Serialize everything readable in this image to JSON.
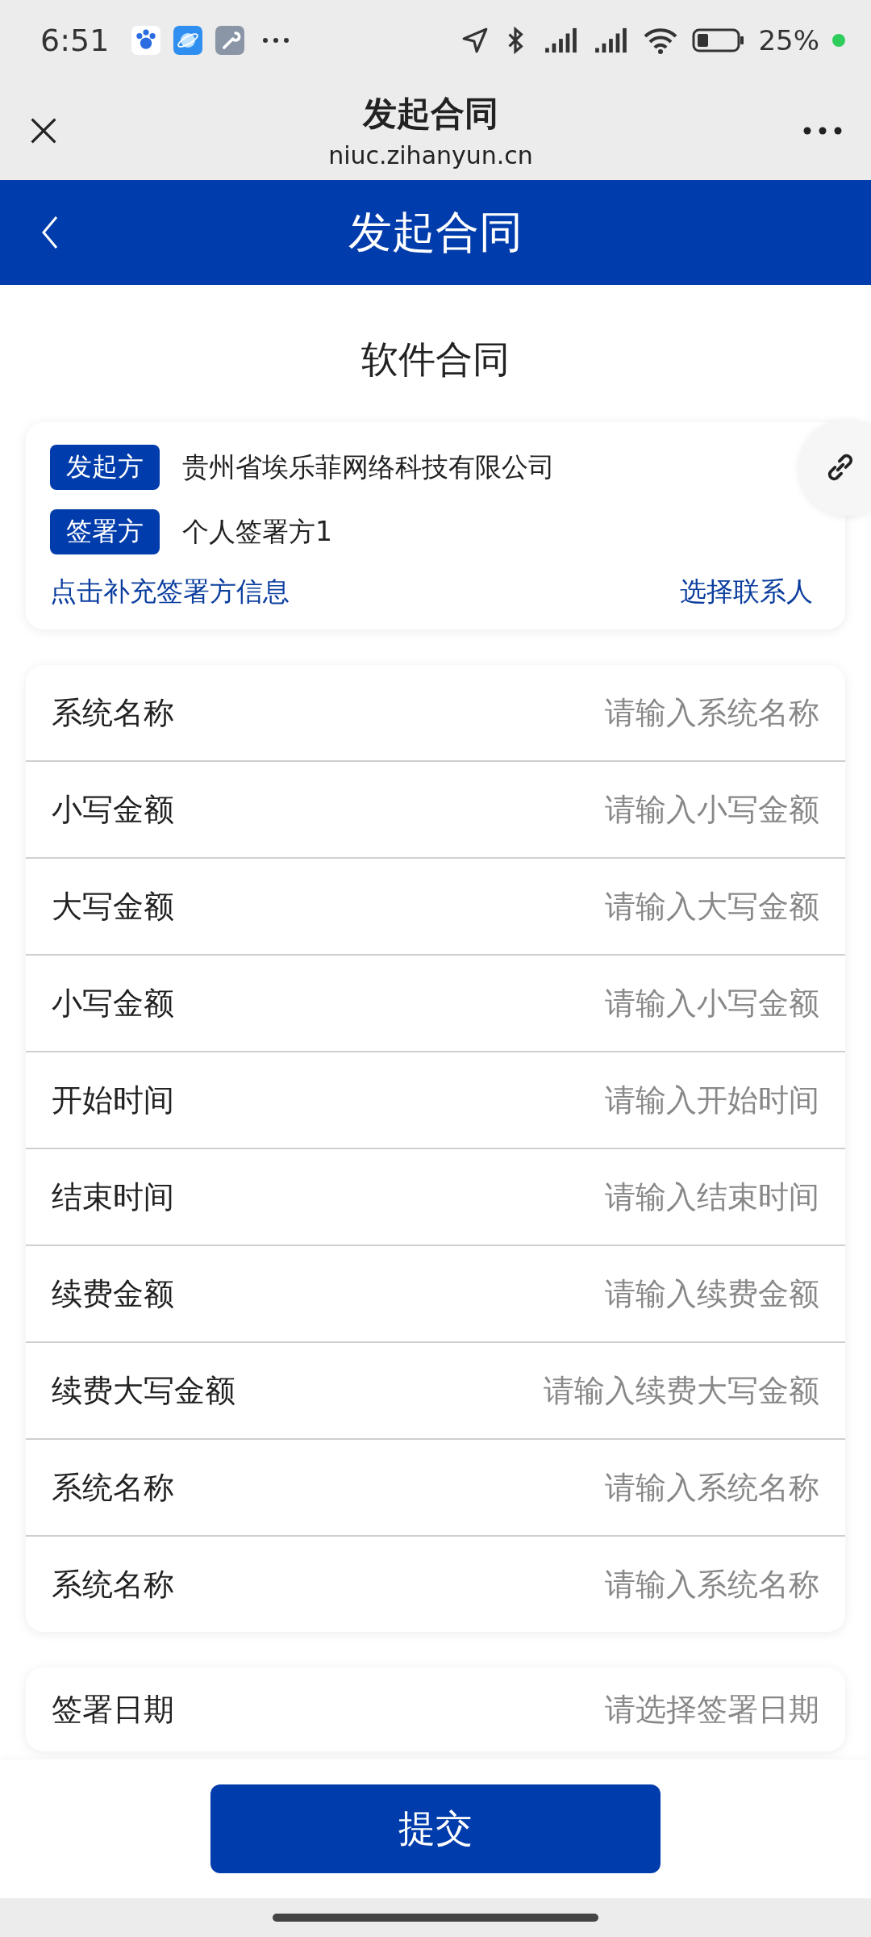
{
  "status_bar": {
    "time": "6:51",
    "battery": "25%"
  },
  "browser_bar": {
    "title": "发起合同",
    "url": "niuc.zihanyun.cn"
  },
  "header": {
    "title": "发起合同"
  },
  "contract_title": "软件合同",
  "parties": [
    {
      "tag": "发起方",
      "name": "贵州省埃乐菲网络科技有限公司"
    },
    {
      "tag": "签署方",
      "name": "个人签署方1"
    }
  ],
  "links": {
    "supplement": "点击补充签署方信息",
    "contacts": "选择联系人"
  },
  "form_fields": [
    {
      "label": "系统名称",
      "placeholder": "请输入系统名称"
    },
    {
      "label": "小写金额",
      "placeholder": "请输入小写金额"
    },
    {
      "label": "大写金额",
      "placeholder": "请输入大写金额"
    },
    {
      "label": "小写金额",
      "placeholder": "请输入小写金额"
    },
    {
      "label": "开始时间",
      "placeholder": "请输入开始时间"
    },
    {
      "label": "结束时间",
      "placeholder": "请输入结束时间"
    },
    {
      "label": "续费金额",
      "placeholder": "请输入续费金额"
    },
    {
      "label": "续费大写金额",
      "placeholder": "请输入续费大写金额"
    },
    {
      "label": "系统名称",
      "placeholder": "请输入系统名称"
    },
    {
      "label": "系统名称",
      "placeholder": "请输入系统名称"
    }
  ],
  "date_field": {
    "label": "签署日期",
    "placeholder": "请选择签署日期"
  },
  "submit_button": "提交"
}
